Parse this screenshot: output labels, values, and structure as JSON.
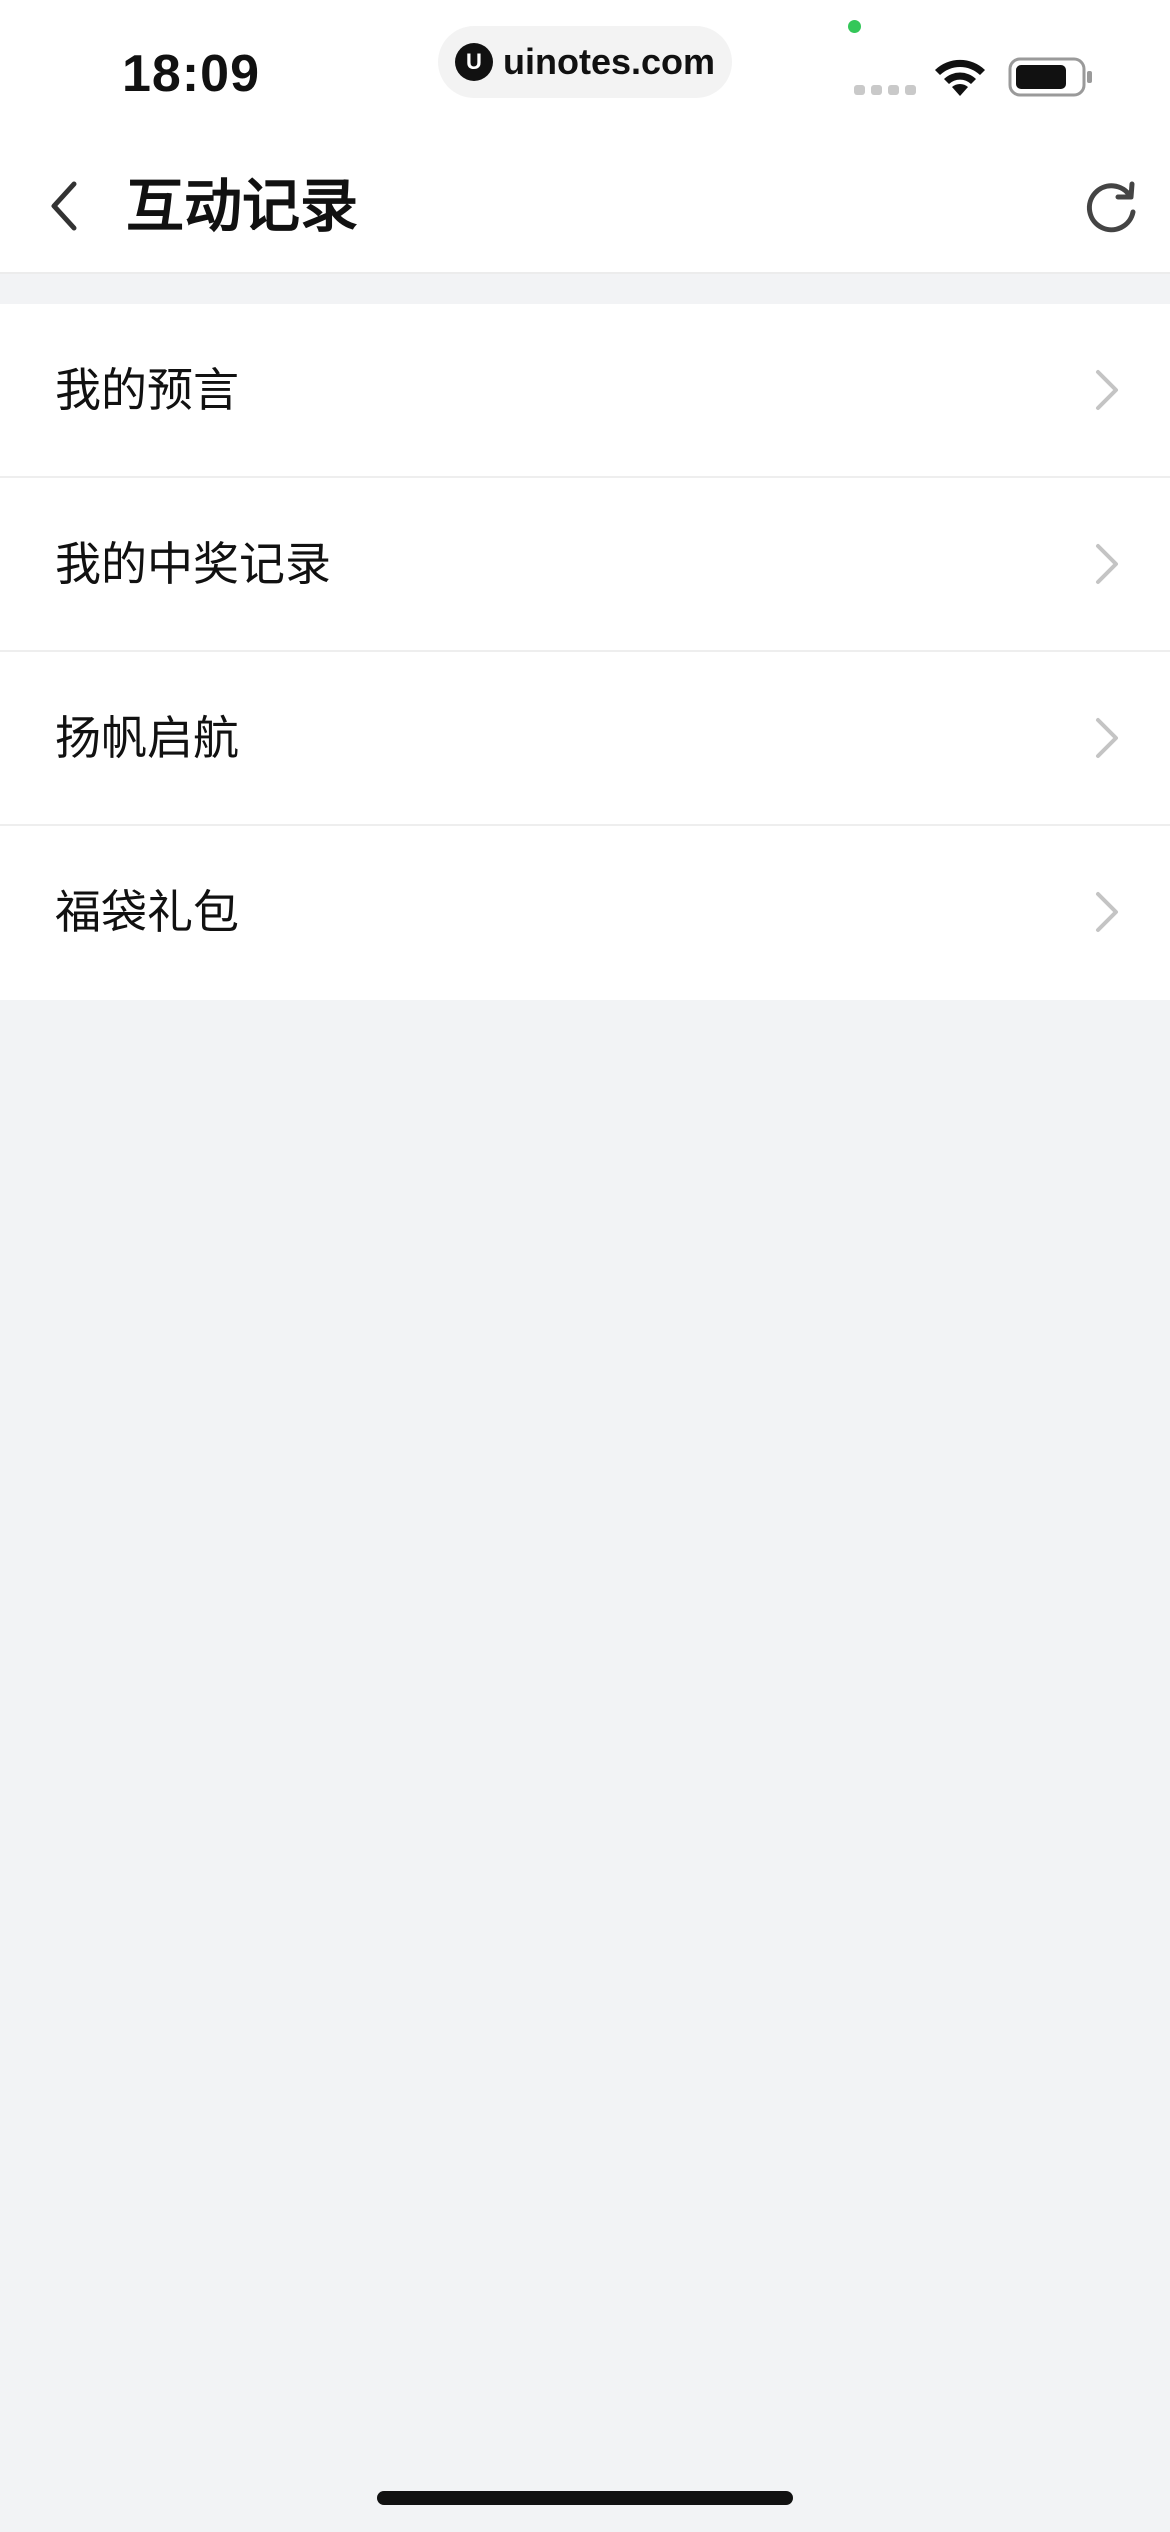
{
  "status_bar": {
    "time": "18:09",
    "url": "uinotes.com",
    "url_icon_glyph": "U"
  },
  "header": {
    "title": "互动记录"
  },
  "list": {
    "items": [
      {
        "label": "我的预言"
      },
      {
        "label": "我的中奖记录"
      },
      {
        "label": "扬帆启航"
      },
      {
        "label": "福袋礼包"
      }
    ]
  },
  "colors": {
    "background": "#f2f3f5",
    "surface": "#ffffff",
    "text": "#111111",
    "chevron": "#c4c4c4",
    "status_dot": "#34c759"
  }
}
